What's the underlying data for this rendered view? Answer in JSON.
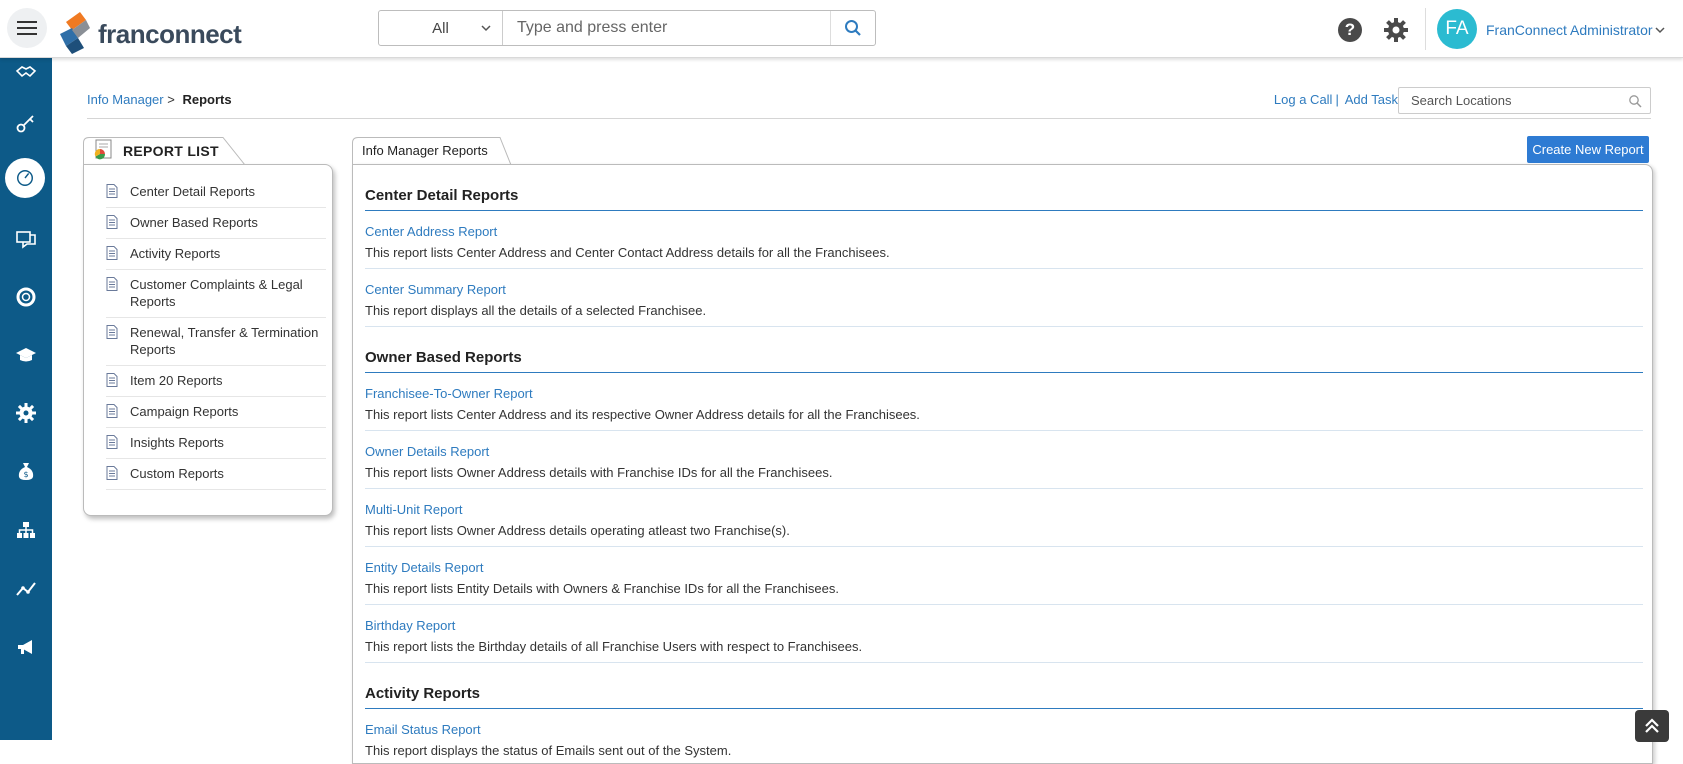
{
  "header": {
    "brand": "franconnect",
    "search": {
      "scope": "All",
      "placeholder": "Type and press enter"
    },
    "user": {
      "initials": "FA",
      "name": "FranConnect Administrator"
    },
    "icons": [
      "menu-icon",
      "search-icon",
      "help-icon",
      "gear-icon",
      "chevron-down-icon"
    ],
    "colors": {
      "avatar": "#2bbbd1",
      "link": "#2e7bbf",
      "nav": "#0d5a88"
    }
  },
  "leftnav": {
    "items": [
      {
        "name": "handshake-icon"
      },
      {
        "name": "key-icon"
      },
      {
        "name": "dashboard-icon",
        "active": true
      },
      {
        "name": "chat-icon"
      },
      {
        "name": "support-icon"
      },
      {
        "name": "graduation-cap-icon"
      },
      {
        "name": "settings-icon"
      },
      {
        "name": "money-bag-icon"
      },
      {
        "name": "org-chart-icon"
      },
      {
        "name": "trend-icon"
      },
      {
        "name": "megaphone-icon"
      }
    ]
  },
  "breadcrumb": {
    "parent": "Info Manager",
    "separator": ">",
    "current": "Reports"
  },
  "toplinks": {
    "log_call": "Log a Call",
    "sep": "|",
    "add_task": "Add Task",
    "search_placeholder": "Search Locations"
  },
  "report_list": {
    "title": "REPORT LIST",
    "items": [
      "Center Detail Reports",
      "Owner Based Reports",
      "Activity Reports",
      "Customer Complaints & Legal Reports",
      "Renewal, Transfer & Termination Reports",
      "Item 20 Reports",
      "Campaign Reports",
      "Insights Reports",
      "Custom Reports"
    ]
  },
  "main": {
    "tab_title": "Info Manager Reports",
    "create_button": "Create New Report",
    "sections": [
      {
        "title": "Center Detail Reports",
        "reports": [
          {
            "name": "Center Address Report",
            "desc": "This report lists Center Address and Center Contact Address details for all the Franchisees."
          },
          {
            "name": "Center Summary Report",
            "desc": "This report displays all the details of a selected Franchisee."
          }
        ]
      },
      {
        "title": "Owner Based Reports",
        "reports": [
          {
            "name": "Franchisee-To-Owner Report",
            "desc": "This report lists Center Address and its respective Owner Address details for all the Franchisees."
          },
          {
            "name": "Owner Details Report",
            "desc": "This report lists Owner Address details with Franchise IDs for all the Franchisees."
          },
          {
            "name": "Multi-Unit Report",
            "desc": "This report lists Owner Address details operating atleast two Franchise(s)."
          },
          {
            "name": "Entity Details Report",
            "desc": "This report lists Entity Details with Owners & Franchise IDs for all the Franchisees."
          },
          {
            "name": "Birthday Report",
            "desc": "This report lists the Birthday details of all Franchise Users with respect to Franchisees."
          }
        ]
      },
      {
        "title": "Activity Reports",
        "reports": [
          {
            "name": "Email Status Report",
            "desc": "This report displays the status of Emails sent out of the System."
          }
        ]
      }
    ]
  }
}
